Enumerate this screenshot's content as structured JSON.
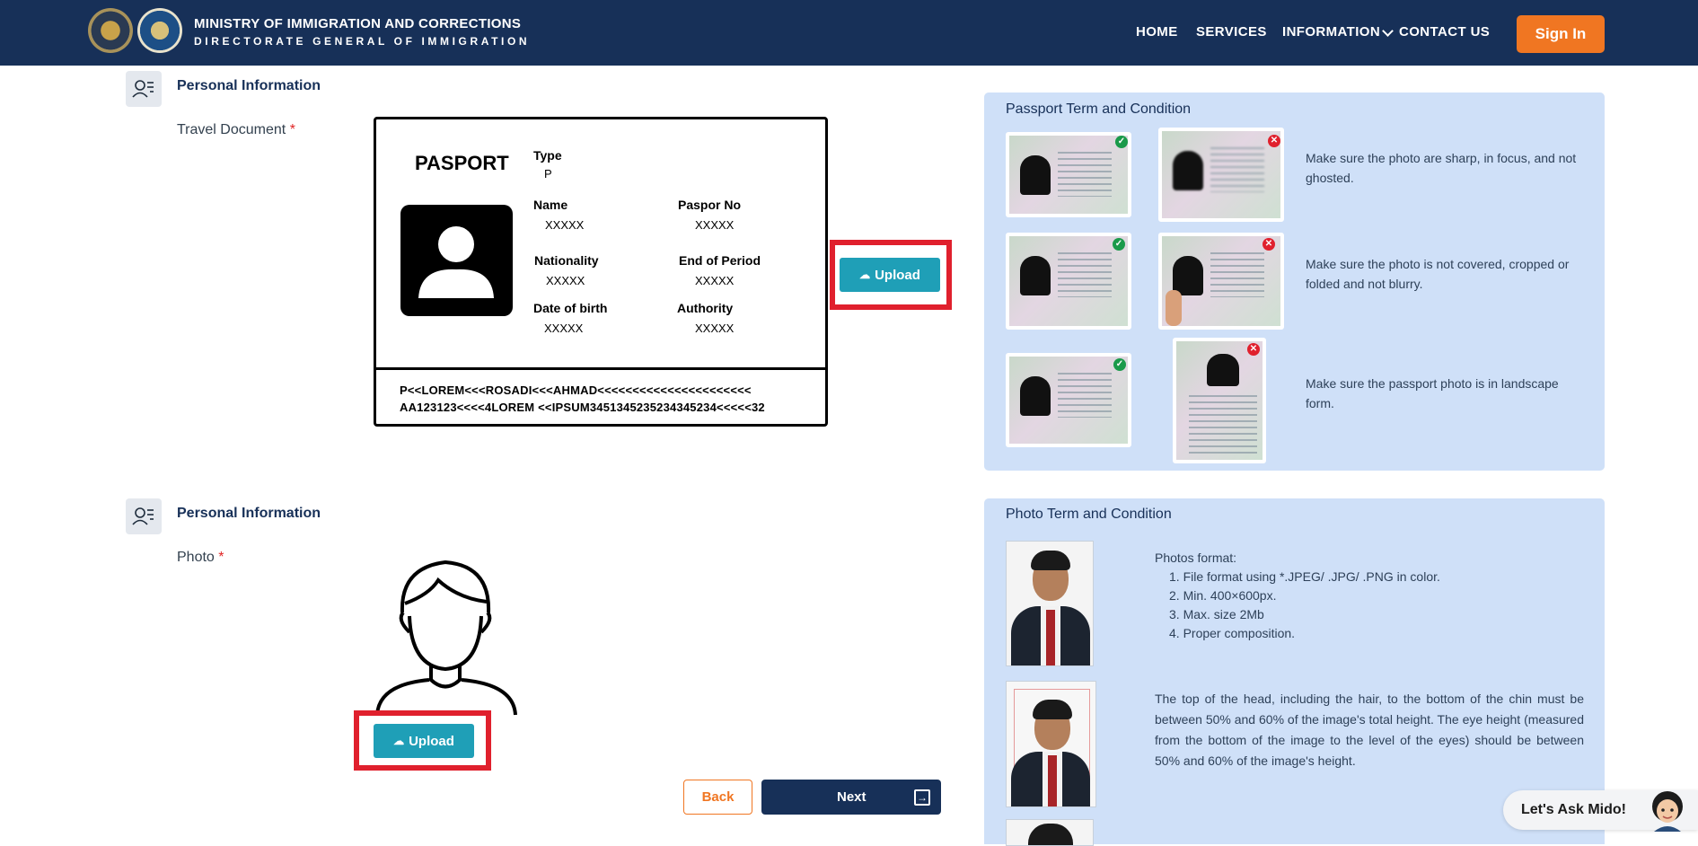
{
  "header": {
    "title_line1": "MINISTRY OF IMMIGRATION AND CORRECTIONS",
    "title_line2": "DIRECTORATE GENERAL OF IMMIGRATION",
    "nav": [
      "HOME",
      "SERVICES",
      "INFORMATION",
      "CONTACT US"
    ],
    "sign_in": "Sign In"
  },
  "section1": {
    "title": "Personal Information",
    "field": "Travel Document",
    "required": "*",
    "passport": {
      "title": "PASPORT",
      "type_label": "Type",
      "type_value": "P",
      "name_label": "Name",
      "name_value": "XXXXX",
      "paspor_no_label": "Paspor No",
      "paspor_no_value": "XXXXX",
      "nationality_label": "Nationality",
      "nationality_value": "XXXXX",
      "end_label": "End of Period",
      "end_value": "XXXXX",
      "dob_label": "Date of birth",
      "dob_value": "XXXXX",
      "authority_label": "Authority",
      "authority_value": "XXXXX",
      "mrz1": "P<<LOREM<<<ROSADI<<<AHMAD<<<<<<<<<<<<<<<<<<<<<<",
      "mrz2": "AA123123<<<<4LOREM <<IPSUM3451345235234345234<<<<<32"
    },
    "upload": "Upload"
  },
  "section2": {
    "title": "Personal Information",
    "field": "Photo",
    "required": "*",
    "upload": "Upload"
  },
  "passport_terms": {
    "title": "Passport Term and Condition",
    "rules": [
      "Make sure the photo are sharp, in focus, and not ghosted.",
      "Make sure the photo is not covered, cropped or folded and not blurry.",
      "Make sure the passport photo is in landscape form."
    ]
  },
  "photo_terms": {
    "title": "Photo Term and Condition",
    "format_heading": "Photos format:",
    "format_items": [
      "1. File format using *.JPEG/ .JPG/ .PNG in color.",
      "2. Min. 400×600px.",
      "3. Max. size 2Mb",
      "4. Proper composition."
    ],
    "head_rule": "The top of the head, including the hair, to the bottom of the chin must be between 50% and 60% of the image's total height. The eye height (measured from the bottom of the image to the level of the eyes) should be between 50% and 60% of the image's height."
  },
  "buttons": {
    "back": "Back",
    "next": "Next"
  },
  "chat": {
    "label": "Let's Ask Mido!"
  },
  "colors": {
    "navy": "#173058",
    "orange": "#f07622",
    "teal": "#1f9fb7",
    "highlight": "#e0202d",
    "panel": "#cfe0f8"
  },
  "icons": {
    "section": "user-list-icon",
    "upload": "cloud-upload-icon",
    "next": "arrow-right-box-icon",
    "ok": "check-badge-icon",
    "bad": "x-badge-icon"
  }
}
